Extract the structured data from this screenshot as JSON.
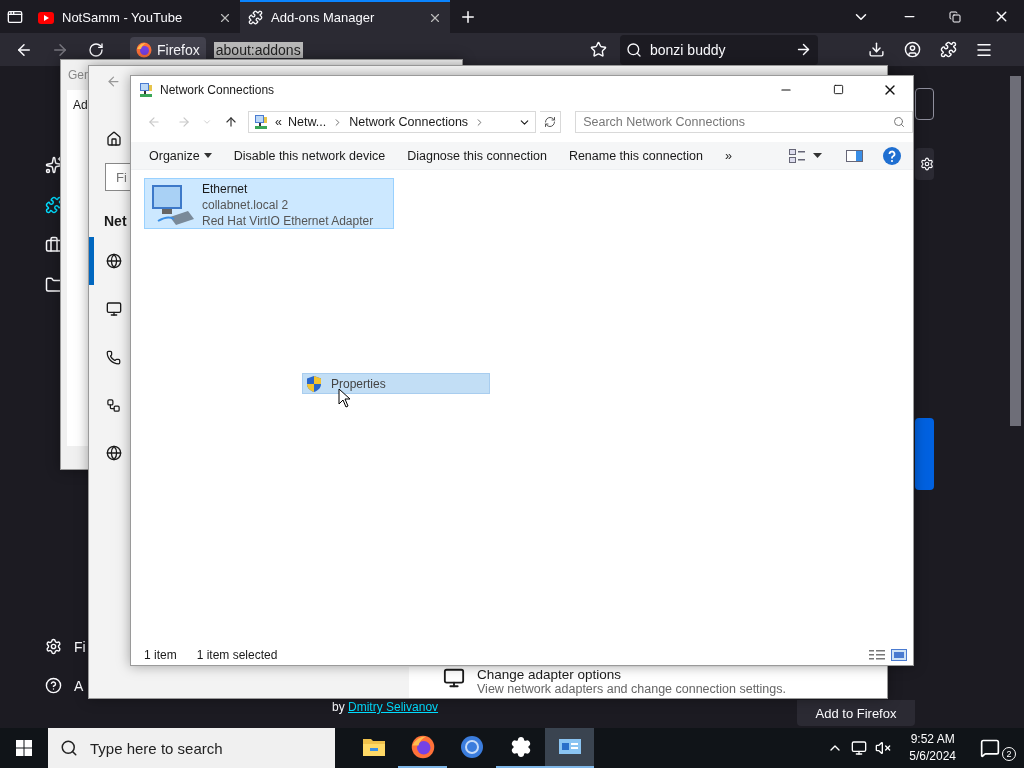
{
  "browser": {
    "tabs": [
      {
        "title": "NotSamm - YouTube",
        "kind": "youtube",
        "selected": false
      },
      {
        "title": "Add-ons Manager",
        "kind": "addons",
        "selected": true
      }
    ],
    "identity": "Firefox",
    "url": "about:addons",
    "search": {
      "value": "bonzi buddy"
    },
    "sidebar": {
      "bottom_items": [
        {
          "kind": "settings",
          "label": "Fi"
        },
        {
          "kind": "help",
          "label": "A"
        }
      ]
    },
    "addon": {
      "author_prefix": "by",
      "author": "Dmitry Selivanov",
      "button": "Add to Firefox"
    }
  },
  "back_window": {
    "title": "Gen",
    "tab": "Ad"
  },
  "settings_window": {
    "search": {
      "placeholder": "Fi"
    },
    "heading": "Net",
    "nav": [
      {
        "kind": "status",
        "selected": true
      },
      {
        "kind": "ethernet",
        "selected": false
      },
      {
        "kind": "dialup",
        "selected": false
      },
      {
        "kind": "vpn",
        "selected": false
      },
      {
        "kind": "proxy",
        "selected": false
      }
    ],
    "option": {
      "title": "Change adapter options",
      "description": "View network adapters and change connection settings."
    }
  },
  "explorer": {
    "title": "Network Connections",
    "breadcrumb": [
      "«",
      "Netw...",
      "Network Connections"
    ],
    "search": {
      "placeholder": "Search Network Connections"
    },
    "commands": [
      "Organize",
      "Disable this network device",
      "Diagnose this connection",
      "Rename this connection",
      "»"
    ],
    "items": [
      {
        "name": "Ethernet",
        "network": "collabnet.local 2",
        "adapter": "Red Hat VirtIO Ethernet Adapter",
        "selected": true
      }
    ],
    "status": [
      "1 item",
      "1 item selected"
    ]
  },
  "drag_ghost": {
    "label": "Properties"
  },
  "taskbar": {
    "search": {
      "placeholder": "Type here to search"
    },
    "apps": [
      {
        "kind": "folder",
        "running": false,
        "selected": false
      },
      {
        "kind": "firefox",
        "running": true,
        "selected": false
      },
      {
        "kind": "browser",
        "running": false,
        "selected": false
      },
      {
        "kind": "settings",
        "running": true,
        "selected": false
      },
      {
        "kind": "control-panel",
        "running": true,
        "selected": true
      }
    ],
    "time": "9:52 AM",
    "date": "5/6/2024",
    "notifications": "2"
  }
}
